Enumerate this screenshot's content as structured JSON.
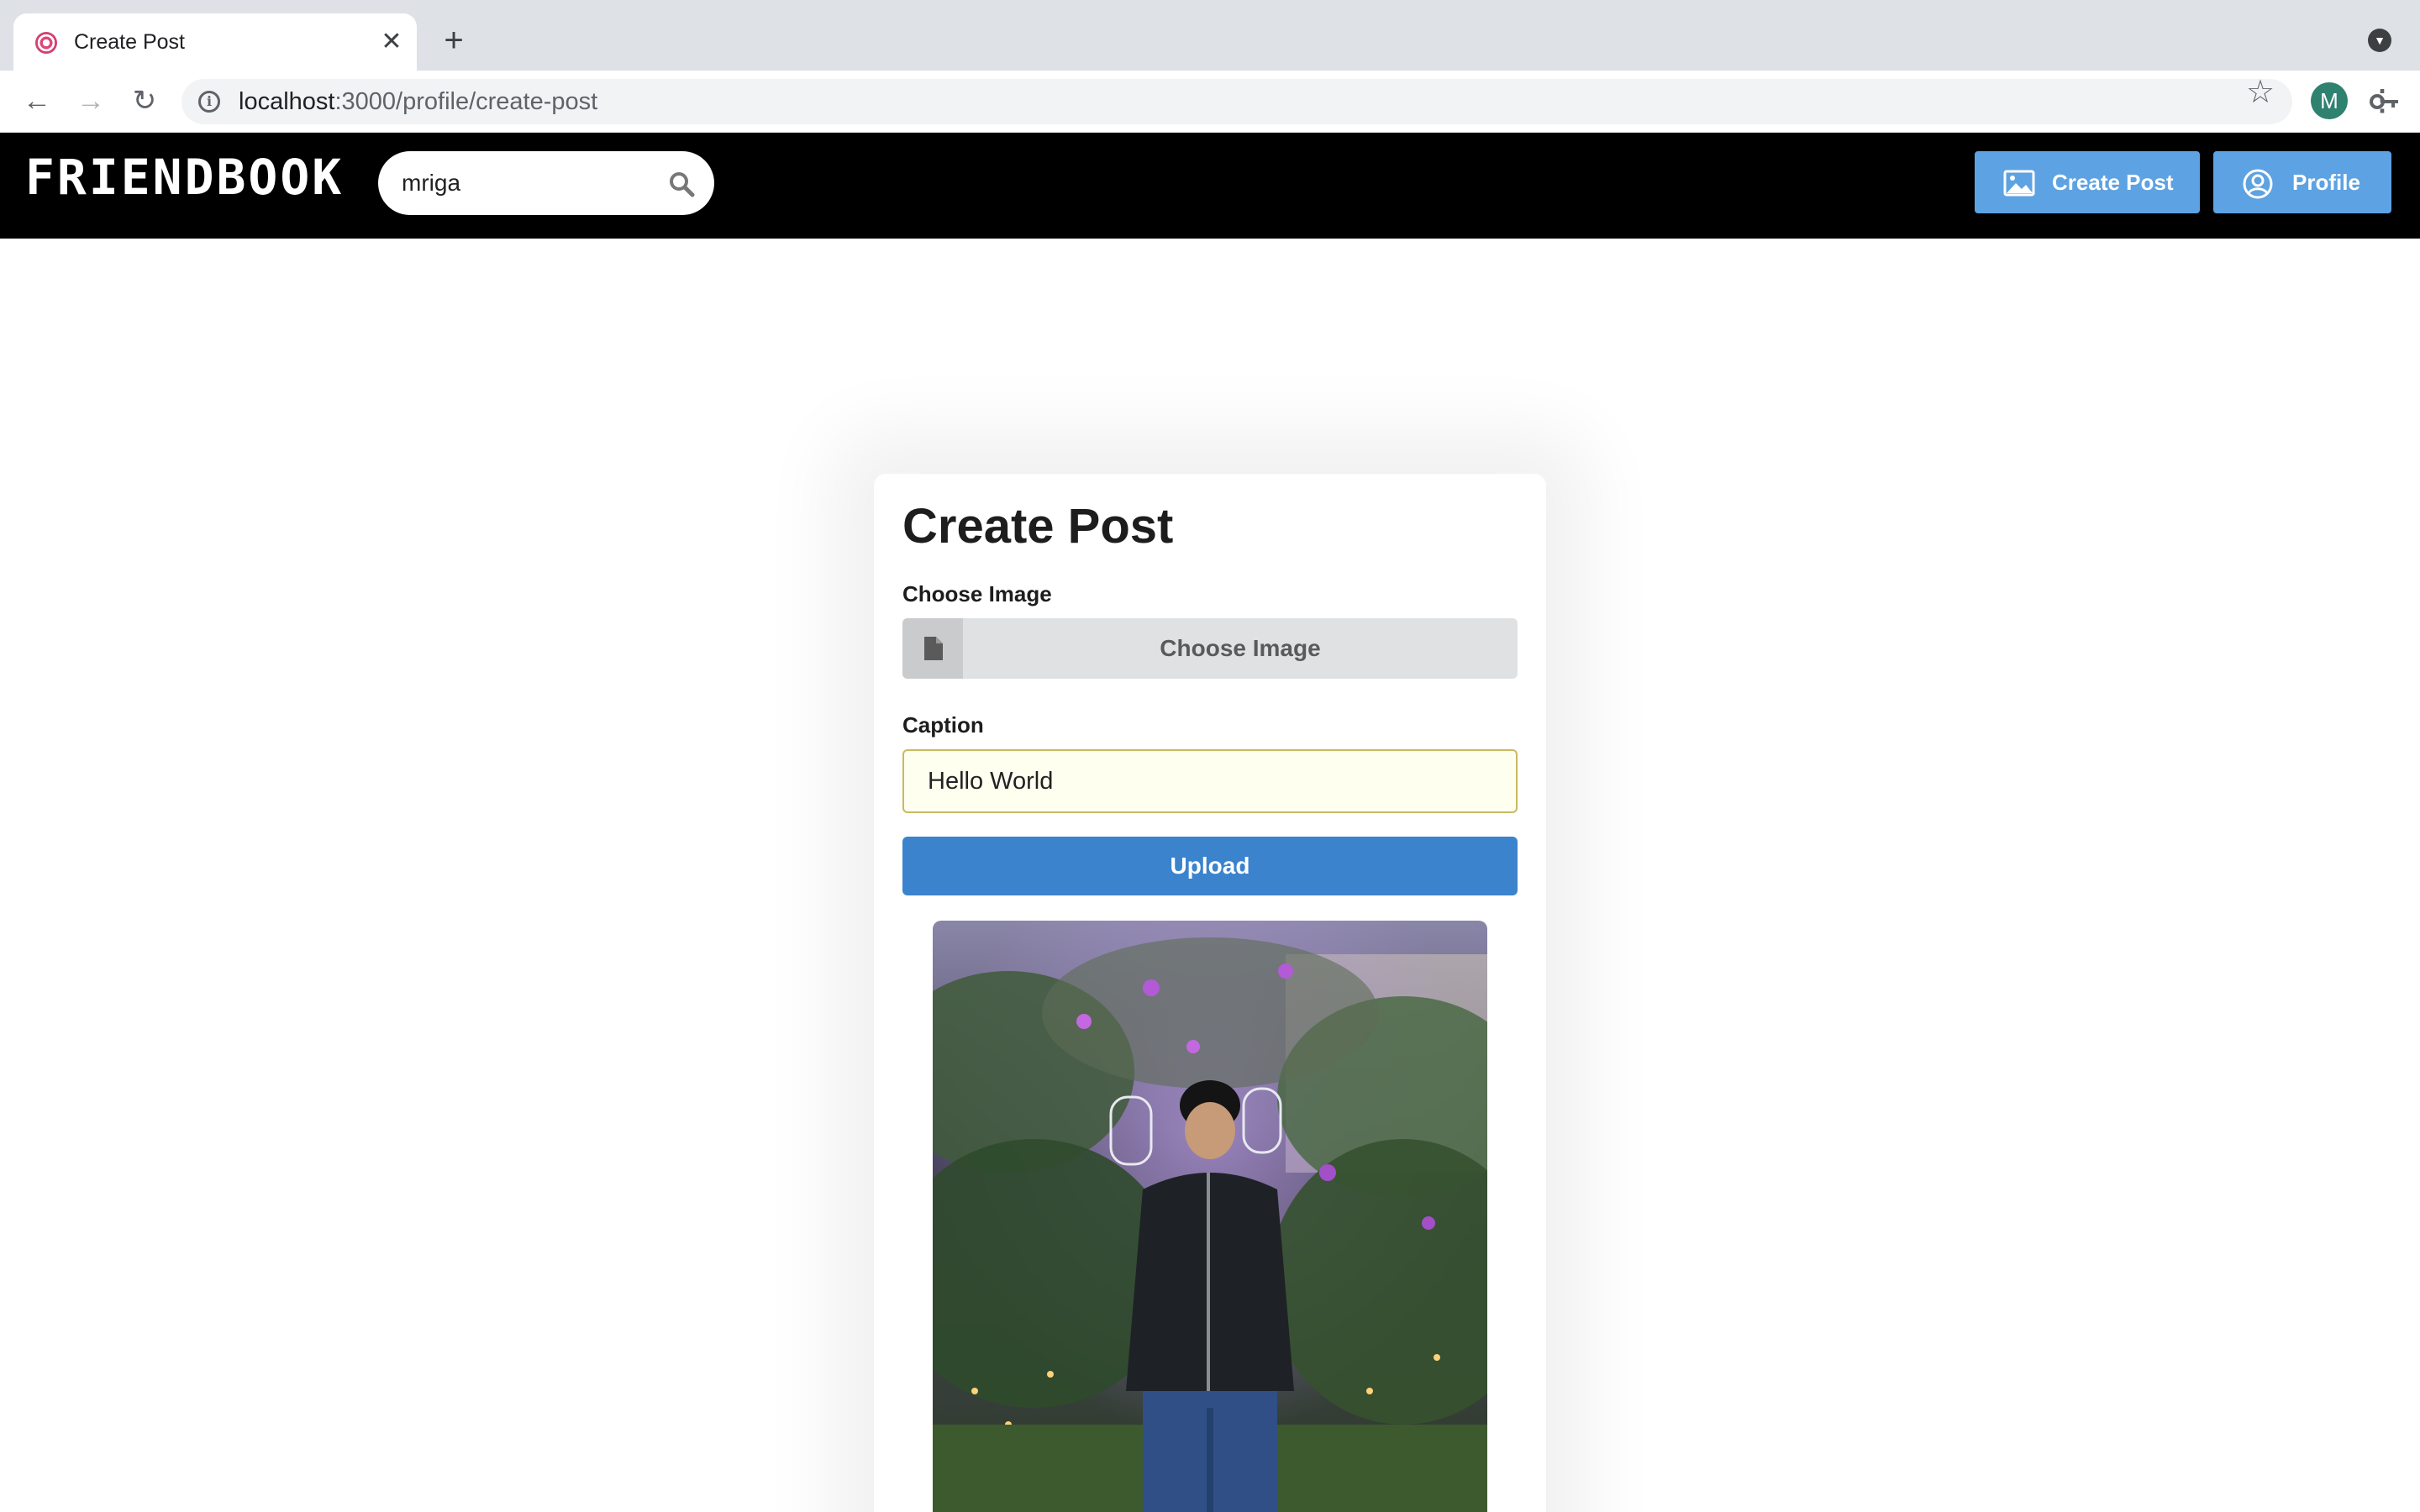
{
  "browser": {
    "tab_title": "Create Post",
    "tab_close": "✕",
    "new_tab": "+",
    "url_host": "localhost",
    "url_path": ":3000/profile/create-post",
    "profile_initial": "M",
    "icons": [
      "back-icon",
      "forward-icon",
      "reload-icon",
      "info-icon",
      "key-icon",
      "star-icon",
      "menu-icon",
      "tab-search-icon"
    ]
  },
  "header": {
    "logo": "FRIENDBOOK",
    "search_value": "mriga",
    "create_post_label": "Create Post",
    "profile_label": "Profile",
    "colors": {
      "bar": "#000000",
      "button": "#5da2e2"
    }
  },
  "form": {
    "title": "Create Post",
    "image_label": "Choose Image",
    "image_button": "Choose Image",
    "caption_label": "Caption",
    "caption_value": "Hello World",
    "upload_label": "Upload",
    "colors": {
      "upload": "#3b83cd",
      "caption_bg": "#fffff0",
      "caption_border": "#c9ba61"
    }
  }
}
